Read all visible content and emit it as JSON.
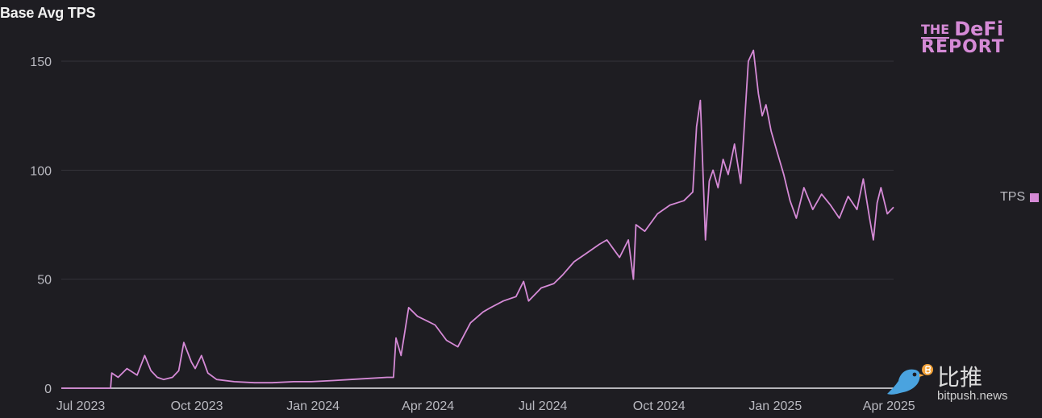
{
  "colors": {
    "background": "#1e1d22",
    "line": "#d58ad6",
    "grid": "#34333a",
    "tick_text": "#b9b9c0",
    "brand": "#d58ad6",
    "watermark_bird": "#4aa3df"
  },
  "logo": {
    "the": "THE",
    "defi": "DeFi",
    "report": "REPORT"
  },
  "watermark": {
    "chinese_text": "比推",
    "url": "bitpush.news",
    "icon": "bird-logo-icon"
  },
  "chart_data": {
    "type": "line",
    "title": "Base Avg TPS",
    "xlabel": "",
    "ylabel": "",
    "ylim": [
      0,
      160
    ],
    "yticks": [
      0,
      50,
      100,
      150
    ],
    "grid": true,
    "legend_position": "right",
    "x_tick_labels": [
      "Jul 2023",
      "Oct 2023",
      "Jan 2024",
      "Apr 2024",
      "Jul 2024",
      "Oct 2024",
      "Jan 2025",
      "Apr 2025"
    ],
    "x_tick_dates": [
      "2023-07-01",
      "2023-10-01",
      "2024-01-01",
      "2024-04-01",
      "2024-07-01",
      "2024-10-01",
      "2025-01-01",
      "2025-04-01"
    ],
    "series": [
      {
        "name": "TPS",
        "x": [
          "2023-07-01",
          "2023-07-20",
          "2023-08-09",
          "2023-08-10",
          "2023-08-15",
          "2023-08-22",
          "2023-08-30",
          "2023-09-05",
          "2023-09-10",
          "2023-09-15",
          "2023-09-20",
          "2023-09-27",
          "2023-10-02",
          "2023-10-06",
          "2023-10-12",
          "2023-10-15",
          "2023-10-20",
          "2023-10-25",
          "2023-11-01",
          "2023-11-15",
          "2023-12-01",
          "2023-12-15",
          "2024-01-01",
          "2024-01-15",
          "2024-02-01",
          "2024-02-15",
          "2024-03-01",
          "2024-03-15",
          "2024-03-20",
          "2024-03-22",
          "2024-03-26",
          "2024-04-01",
          "2024-04-08",
          "2024-04-15",
          "2024-04-22",
          "2024-05-01",
          "2024-05-10",
          "2024-05-20",
          "2024-05-30",
          "2024-06-05",
          "2024-06-15",
          "2024-06-25",
          "2024-07-01",
          "2024-07-05",
          "2024-07-15",
          "2024-07-25",
          "2024-08-01",
          "2024-08-10",
          "2024-08-20",
          "2024-08-30",
          "2024-09-05",
          "2024-09-15",
          "2024-09-22",
          "2024-09-26",
          "2024-09-28",
          "2024-10-05",
          "2024-10-15",
          "2024-10-25",
          "2024-11-05",
          "2024-11-12",
          "2024-11-15",
          "2024-11-18",
          "2024-11-22",
          "2024-11-25",
          "2024-11-28",
          "2024-12-02",
          "2024-12-06",
          "2024-12-10",
          "2024-12-15",
          "2024-12-20",
          "2024-12-26",
          "2024-12-30",
          "2025-01-03",
          "2025-01-06",
          "2025-01-09",
          "2025-01-13",
          "2025-01-18",
          "2025-01-23",
          "2025-01-28",
          "2025-02-02",
          "2025-02-08",
          "2025-02-15",
          "2025-02-22",
          "2025-03-01",
          "2025-03-08",
          "2025-03-15",
          "2025-03-22",
          "2025-03-27",
          "2025-04-01",
          "2025-04-04",
          "2025-04-07",
          "2025-04-10",
          "2025-04-15",
          "2025-04-20"
        ],
        "values": [
          0,
          0,
          0,
          7,
          5,
          9,
          6,
          15,
          8,
          5,
          4,
          5,
          8,
          21,
          12,
          9,
          15,
          7,
          4,
          3,
          2.5,
          2.5,
          3,
          3,
          3.5,
          4,
          4.5,
          5,
          5,
          23,
          15,
          37,
          33,
          31,
          29,
          22,
          19,
          30,
          35,
          37,
          40,
          42,
          49,
          40,
          46,
          48,
          52,
          58,
          62,
          66,
          68,
          60,
          68,
          50,
          75,
          72,
          80,
          84,
          86,
          90,
          120,
          132,
          68,
          95,
          100,
          92,
          105,
          98,
          112,
          94,
          150,
          155,
          135,
          125,
          130,
          118,
          108,
          98,
          86,
          78,
          92,
          82,
          89,
          84,
          78,
          88,
          82,
          96,
          78,
          68,
          85,
          92,
          80,
          83
        ],
        "color": "#d58ad6"
      }
    ]
  }
}
